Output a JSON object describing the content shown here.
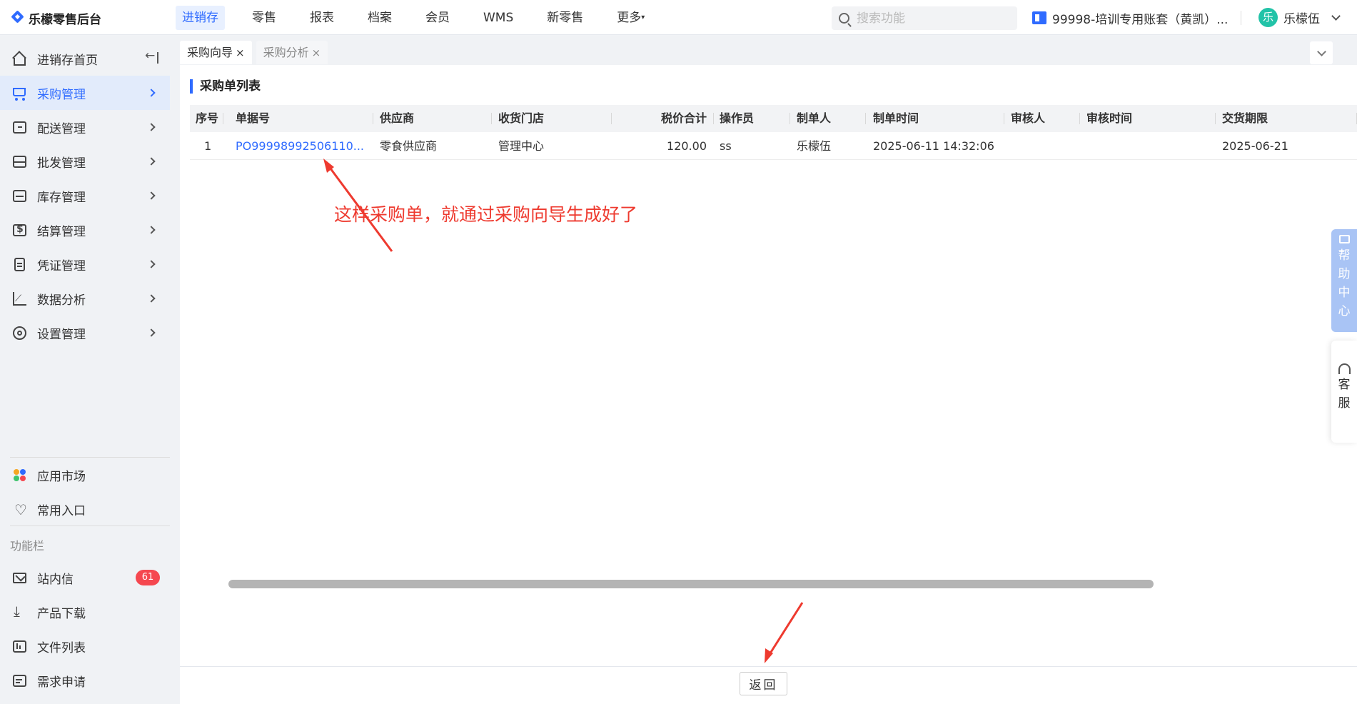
{
  "app": {
    "title": "乐檬零售后台"
  },
  "nav": {
    "items": [
      "进销存",
      "零售",
      "报表",
      "档案",
      "会员",
      "WMS",
      "新零售",
      "更多"
    ],
    "active_index": 0
  },
  "search": {
    "placeholder": "搜索功能"
  },
  "account": {
    "name": "99998-培训专用账套（黄凯）..."
  },
  "user": {
    "avatar_char": "乐",
    "name": "乐檬伍"
  },
  "sidebar": {
    "items": [
      {
        "label": "进销存首页",
        "icon": "home-icon"
      },
      {
        "label": "采购管理",
        "icon": "cart-icon",
        "active": true
      },
      {
        "label": "配送管理",
        "icon": "delivery-icon"
      },
      {
        "label": "批发管理",
        "icon": "wholesale-icon"
      },
      {
        "label": "库存管理",
        "icon": "inventory-icon"
      },
      {
        "label": "结算管理",
        "icon": "settlement-icon"
      },
      {
        "label": "凭证管理",
        "icon": "voucher-icon"
      },
      {
        "label": "数据分析",
        "icon": "chart-icon"
      },
      {
        "label": "设置管理",
        "icon": "settings-icon"
      }
    ],
    "bottom": [
      {
        "label": "应用市场",
        "icon": "app-market-icon"
      },
      {
        "label": "常用入口",
        "icon": "heart-icon"
      }
    ],
    "group_label": "功能栏",
    "functions": [
      {
        "label": "站内信",
        "icon": "mail-icon",
        "badge": "61"
      },
      {
        "label": "产品下载",
        "icon": "download-icon"
      },
      {
        "label": "文件列表",
        "icon": "file-list-icon"
      },
      {
        "label": "需求申请",
        "icon": "request-icon"
      }
    ]
  },
  "tabs": [
    {
      "label": "采购向导",
      "active": true
    },
    {
      "label": "采购分析",
      "active": false
    }
  ],
  "section": {
    "title": "采购单列表"
  },
  "table": {
    "columns": [
      "序号",
      "单据号",
      "供应商",
      "收货门店",
      "税价合计",
      "操作员",
      "制单人",
      "制单时间",
      "审核人",
      "审核时间",
      "交货期限"
    ],
    "rows": [
      [
        "1",
        "PO99998992506110...",
        "零食供应商",
        "管理中心",
        "120.00",
        "ss",
        "乐檬伍",
        "2025-06-11 14:32:06",
        "",
        "",
        "2025-06-21"
      ]
    ]
  },
  "annotation": {
    "text": "这样采购单，就通过采购向导生成好了",
    "color": "#ee3a2f"
  },
  "footer": {
    "back_label": "返回"
  },
  "float": {
    "help_label": [
      "帮",
      "助",
      "中",
      "心"
    ],
    "service_label": [
      "客",
      "服"
    ]
  },
  "colors": {
    "accent": "#2f6bff",
    "badge": "#f5474f",
    "annotation": "#ee3a2f"
  }
}
